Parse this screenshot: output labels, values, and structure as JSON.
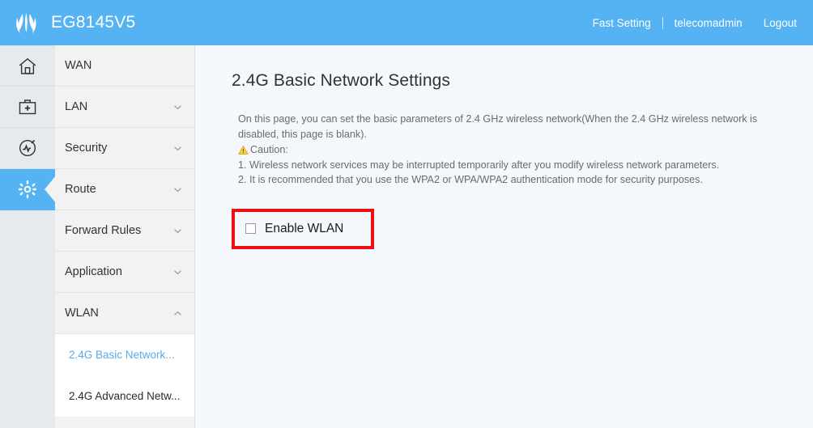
{
  "header": {
    "brand": "EG8145V5",
    "logo_icon": "huawei-flower-logo",
    "fast_setting": "Fast Setting",
    "username": "telecomadmin",
    "logout": "Logout"
  },
  "icon_rail": {
    "items": [
      {
        "icon": "home-icon",
        "name": "home",
        "active": false
      },
      {
        "icon": "toolkit-plus-icon",
        "name": "maintenance",
        "active": false
      },
      {
        "icon": "gauge-icon",
        "name": "diagnosis",
        "active": false
      },
      {
        "icon": "gear-icon",
        "name": "advanced-settings",
        "active": true
      }
    ]
  },
  "nav": {
    "items": [
      {
        "label": "WAN",
        "chevron": "none"
      },
      {
        "label": "LAN",
        "chevron": "down"
      },
      {
        "label": "Security",
        "chevron": "down"
      },
      {
        "label": "Route",
        "chevron": "down"
      },
      {
        "label": "Forward Rules",
        "chevron": "down"
      },
      {
        "label": "Application",
        "chevron": "down"
      },
      {
        "label": "WLAN",
        "chevron": "up"
      }
    ],
    "submenu": [
      {
        "label": "2.4G Basic Network...",
        "active": true
      },
      {
        "label": "2.4G Advanced Netw...",
        "active": false
      }
    ]
  },
  "content": {
    "title": "2.4G Basic Network Settings",
    "description_line1": "On this page, you can set the basic parameters of 2.4 GHz wireless network(When the 2.4 GHz wireless network is",
    "description_line2": "disabled, this page is blank).",
    "caution_label": "Caution:",
    "caution_icon": "warning-triangle-icon",
    "caution_1": "1. Wireless network services may be interrupted temporarily after you modify wireless network parameters.",
    "caution_2": "2. It is recommended that you use the WPA2 or WPA/WPA2 authentication mode for security purposes.",
    "enable_wlan_label": "Enable WLAN",
    "enable_wlan_checked": false
  },
  "colors": {
    "header_blue": "#55b3f3",
    "accent_blue": "#5aabe8",
    "content_bg": "#f4f7fb",
    "nav_bg": "#f2f2f2",
    "rail_bg": "#e4eaee",
    "annotation_red": "#ee1111",
    "caution_yellow": "#f0c020"
  }
}
